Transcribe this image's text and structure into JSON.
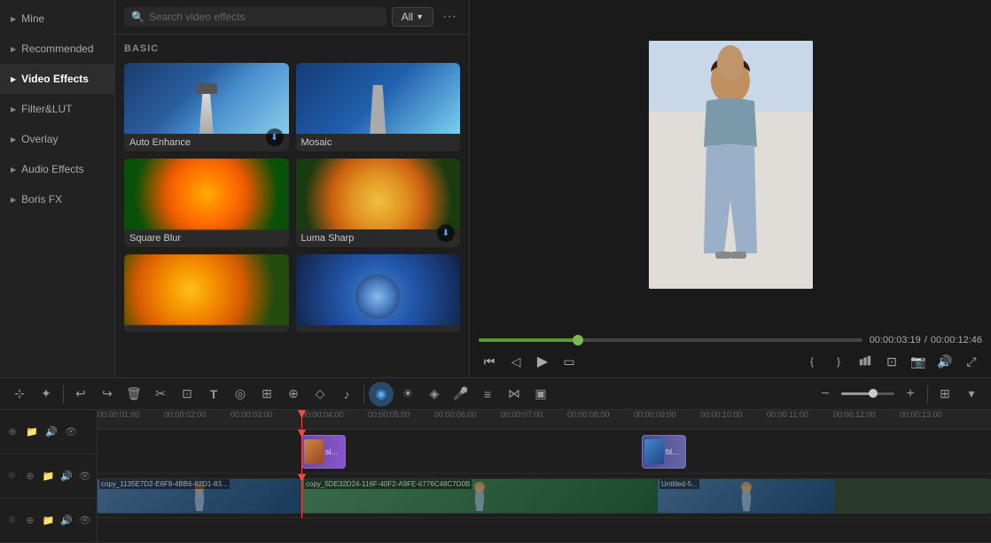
{
  "sidebar": {
    "items": [
      {
        "id": "mine",
        "label": "Mine",
        "active": false
      },
      {
        "id": "recommended",
        "label": "Recommended",
        "active": false
      },
      {
        "id": "video-effects",
        "label": "Video Effects",
        "active": true
      },
      {
        "id": "filter-lut",
        "label": "Filter&LUT",
        "active": false
      },
      {
        "id": "overlay",
        "label": "Overlay",
        "active": false
      },
      {
        "id": "audio-effects",
        "label": "Audio Effects",
        "active": false
      },
      {
        "id": "boris-fx",
        "label": "Boris FX",
        "active": false
      }
    ]
  },
  "effects_panel": {
    "search_placeholder": "Search video effects",
    "filter_label": "All",
    "section_label": "BASIC",
    "effects": [
      {
        "id": "auto-enhance",
        "label": "Auto Enhance",
        "has_download": true
      },
      {
        "id": "mosaic",
        "label": "Mosaic",
        "has_download": false
      },
      {
        "id": "square-blur",
        "label": "Square Blur",
        "has_download": false
      },
      {
        "id": "luma-sharp",
        "label": "Luma Sharp",
        "has_download": true
      },
      {
        "id": "effect5",
        "label": "",
        "has_download": false
      },
      {
        "id": "effect6",
        "label": "",
        "has_download": false
      }
    ]
  },
  "preview": {
    "current_time": "00:00:03:19",
    "total_time": "00:00:12:46",
    "progress_percent": 26
  },
  "toolbar": {
    "tools": [
      {
        "id": "select",
        "icon": "⊹",
        "active": false
      },
      {
        "id": "crop",
        "icon": "✂",
        "active": false
      },
      {
        "id": "undo",
        "icon": "↩",
        "active": false
      },
      {
        "id": "redo",
        "icon": "↪",
        "active": false
      },
      {
        "id": "delete",
        "icon": "🗑",
        "active": false
      },
      {
        "id": "cut",
        "icon": "✂",
        "active": false
      },
      {
        "id": "transform",
        "icon": "⊡",
        "active": false
      },
      {
        "id": "text",
        "icon": "T",
        "active": false
      },
      {
        "id": "draw",
        "icon": "◎",
        "active": false
      },
      {
        "id": "image",
        "icon": "⊞",
        "active": false
      },
      {
        "id": "time",
        "icon": "⊕",
        "active": false
      },
      {
        "id": "shape",
        "icon": "◇",
        "active": false
      },
      {
        "id": "audio",
        "icon": "♪",
        "active": false
      }
    ],
    "zoom_minus": "−",
    "zoom_plus": "+"
  },
  "timeline": {
    "time_marks": [
      "00:00:01:00",
      "00:00:02:00",
      "00:00:03:00",
      "00:00:04:00",
      "00:00:05:00",
      "00:00:06:00",
      "00:00:07:00",
      "00:00:08:00",
      "00:00:09:00",
      "00:00:10:00",
      "00:00:11:00",
      "00:00:12:00",
      "00:00:13:00"
    ],
    "clips": [
      {
        "id": "siji-clip",
        "label": "si...",
        "type": "overlay"
      },
      {
        "id": "bl-clip",
        "label": "bl...",
        "type": "overlay"
      }
    ],
    "main_clips": [
      {
        "id": "clip1",
        "label": "copy_1135E7D2-E6F8-4BB6-82D1-83..."
      },
      {
        "id": "clip2",
        "label": "copy_5DE32D24-116F-40F2-A9FE-6776C48C7D0B"
      },
      {
        "id": "clip3",
        "label": "Untitled-5..."
      }
    ]
  }
}
